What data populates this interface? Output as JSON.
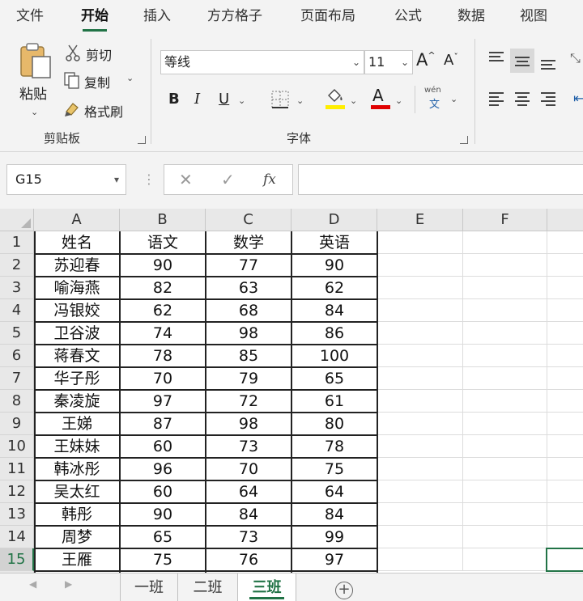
{
  "menu": {
    "tabs": [
      {
        "label": "文件",
        "active": false
      },
      {
        "label": "开始",
        "active": true
      },
      {
        "label": "插入",
        "active": false
      },
      {
        "label": "方方格子",
        "active": false
      },
      {
        "label": "页面布局",
        "active": false
      },
      {
        "label": "公式",
        "active": false
      },
      {
        "label": "数据",
        "active": false
      },
      {
        "label": "视图",
        "active": false
      }
    ]
  },
  "ribbon": {
    "clipboard": {
      "paste_label": "粘贴",
      "cut_label": "剪切",
      "copy_label": "复制",
      "format_painter_label": "格式刷",
      "group_label": "剪贴板"
    },
    "font": {
      "font_name": "等线",
      "font_size": "11",
      "bold": "B",
      "italic": "I",
      "underline": "U",
      "grow": "A",
      "shrink": "A",
      "font_color": "A",
      "phonetic_top": "wén",
      "phonetic_bottom": "文",
      "group_label": "字体",
      "highlight_color": "#ffee00",
      "font_color_swatch": "#e00000"
    }
  },
  "formula_bar": {
    "name_box": "G15",
    "cancel": "✕",
    "enter": "✓",
    "function": "fx",
    "value": ""
  },
  "grid": {
    "columns": [
      "A",
      "B",
      "C",
      "D",
      "E",
      "F"
    ],
    "rows": [
      {
        "num": "1",
        "cells": [
          "姓名",
          "语文",
          "数学",
          "英语"
        ]
      },
      {
        "num": "2",
        "cells": [
          "苏迎春",
          "90",
          "77",
          "90"
        ]
      },
      {
        "num": "3",
        "cells": [
          "喻海燕",
          "82",
          "63",
          "62"
        ]
      },
      {
        "num": "4",
        "cells": [
          "冯银姣",
          "62",
          "68",
          "84"
        ]
      },
      {
        "num": "5",
        "cells": [
          "卫谷波",
          "74",
          "98",
          "86"
        ]
      },
      {
        "num": "6",
        "cells": [
          "蒋春文",
          "78",
          "85",
          "100"
        ]
      },
      {
        "num": "7",
        "cells": [
          "华子彤",
          "70",
          "79",
          "65"
        ]
      },
      {
        "num": "8",
        "cells": [
          "秦凌旋",
          "97",
          "72",
          "61"
        ]
      },
      {
        "num": "9",
        "cells": [
          "王娣",
          "87",
          "98",
          "80"
        ]
      },
      {
        "num": "10",
        "cells": [
          "王妹妹",
          "60",
          "73",
          "78"
        ]
      },
      {
        "num": "11",
        "cells": [
          "韩冰彤",
          "96",
          "70",
          "75"
        ]
      },
      {
        "num": "12",
        "cells": [
          "吴太红",
          "60",
          "64",
          "64"
        ]
      },
      {
        "num": "13",
        "cells": [
          "韩彤",
          "90",
          "84",
          "84"
        ]
      },
      {
        "num": "14",
        "cells": [
          "周梦",
          "65",
          "73",
          "99"
        ]
      },
      {
        "num": "15",
        "cells": [
          "王雁",
          "75",
          "76",
          "97"
        ]
      }
    ],
    "selected_cell": "G15",
    "selected_row": "15",
    "accent_color": "#217346"
  },
  "sheets": {
    "tabs": [
      {
        "label": "一班",
        "active": false
      },
      {
        "label": "二班",
        "active": false
      },
      {
        "label": "三班",
        "active": true
      }
    ],
    "add": "+"
  }
}
